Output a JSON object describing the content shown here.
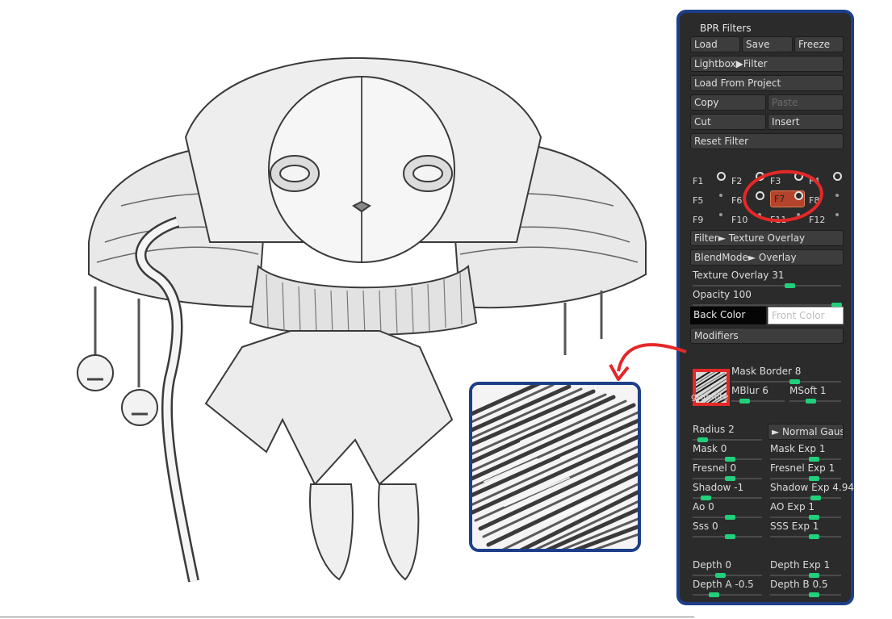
{
  "panel": {
    "title": "BPR Filters",
    "buttons": {
      "load": "Load",
      "save": "Save",
      "freeze": "Freeze",
      "lightbox_filter": "Lightbox▶Filter",
      "load_from_project": "Load From Project",
      "copy": "Copy",
      "paste": "Paste",
      "cut": "Cut",
      "insert": "Insert",
      "reset_filter": "Reset Filter"
    },
    "filter_slots": [
      "F1",
      "F2",
      "F3",
      "F4",
      "F5",
      "F6",
      "F7",
      "F8",
      "F9",
      "F10",
      "F11",
      "F12"
    ],
    "selected_slot": "F7",
    "filter_mode": "Filter► Texture Overlay",
    "blend_mode": "BlendMode► Overlay",
    "texture_overlay": {
      "label": "Texture Overlay",
      "value": "31",
      "level": 0.31
    },
    "opacity": {
      "label": "Opacity",
      "value": "100",
      "level": 1.0
    },
    "back_color": "Back Color",
    "front_color": "Front Color",
    "modifiers": "Modifiers",
    "texture_name": "graphite",
    "mask_border": {
      "label": "Mask Border",
      "value": "8"
    },
    "mblur": {
      "label": "MBlur",
      "value": "6"
    },
    "msoft": {
      "label": "MSoft",
      "value": "1"
    },
    "radius": {
      "label": "Radius",
      "value": "2"
    },
    "gauss_button": "► Normal Gauss",
    "params": [
      {
        "label": "Mask",
        "value": "0"
      },
      {
        "label": "Mask Exp",
        "value": "1"
      },
      {
        "label": "Fresnel",
        "value": "0"
      },
      {
        "label": "Fresnel Exp",
        "value": "1"
      },
      {
        "label": "Shadow",
        "value": "-1"
      },
      {
        "label": "Shadow Exp",
        "value": "4.94"
      },
      {
        "label": "Ao",
        "value": "0"
      },
      {
        "label": "AO Exp",
        "value": "1"
      },
      {
        "label": "Sss",
        "value": "0"
      },
      {
        "label": "SSS Exp",
        "value": "1"
      },
      {
        "label": "Depth",
        "value": "0"
      },
      {
        "label": "Depth Exp",
        "value": "1"
      },
      {
        "label": "Depth A",
        "value": "-0.5"
      },
      {
        "label": "Depth B",
        "value": "0.5"
      }
    ]
  },
  "colors": {
    "panel_bg": "#2b2b2b",
    "panel_border": "#1d3f8a",
    "slider_knob": "#21d07a",
    "selected_slot": "#b4432b",
    "annotation_red": "#e42828"
  }
}
